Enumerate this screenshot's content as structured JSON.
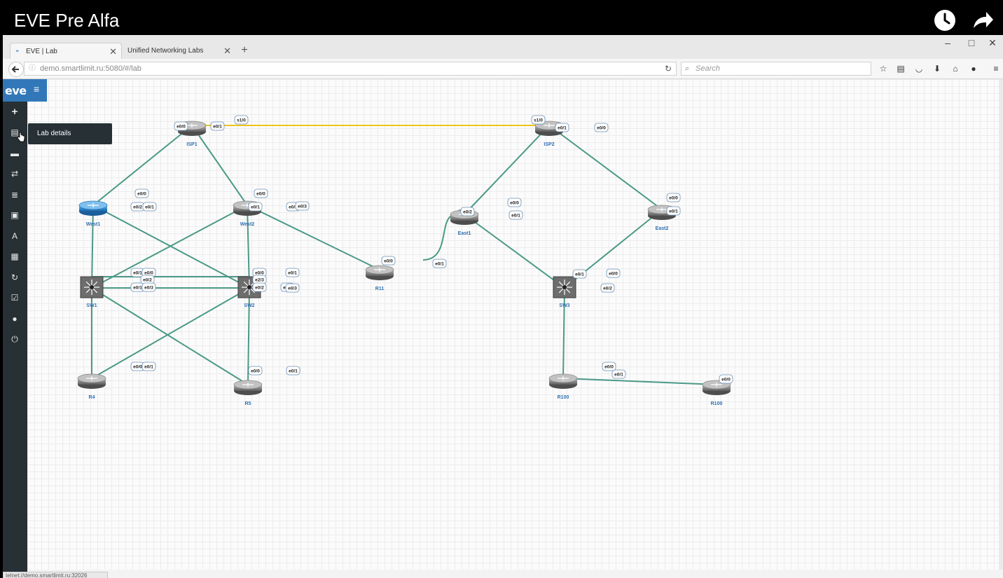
{
  "video": {
    "title": "EVE Pre Alfa",
    "icons": [
      "clock-icon",
      "share-icon"
    ]
  },
  "browser": {
    "tabs": [
      {
        "label": "EVE | Lab",
        "active": true
      },
      {
        "label": "Unified Networking Labs",
        "active": false
      }
    ],
    "new_tab": "+",
    "window_controls": [
      "–",
      "□",
      "✕"
    ],
    "url": "demo.smartlimit.ru:5080/#/lab",
    "search_placeholder": "Search",
    "status_url": "telnet://demo.smartlimit.ru:32026"
  },
  "app": {
    "logo": "eve",
    "tooltip": "Lab details",
    "sidebar_icons": [
      "plus-icon",
      "lab-details-icon",
      "node-icon",
      "network-icon",
      "list-icon",
      "picture-icon",
      "text-icon",
      "grid-icon",
      "refresh-icon",
      "check-icon",
      "info-icon",
      "power-icon"
    ]
  },
  "topology": {
    "nodes": [
      {
        "id": "ISP1",
        "label": "ISP1",
        "type": "router"
      },
      {
        "id": "ISP2",
        "label": "ISP2",
        "type": "router"
      },
      {
        "id": "West1",
        "label": "West1",
        "type": "router-active"
      },
      {
        "id": "West2",
        "label": "West2",
        "type": "router"
      },
      {
        "id": "R11",
        "label": "R11",
        "type": "router"
      },
      {
        "id": "East1",
        "label": "East1",
        "type": "router"
      },
      {
        "id": "East2",
        "label": "East2",
        "type": "router"
      },
      {
        "id": "SW1",
        "label": "SW1",
        "type": "switch"
      },
      {
        "id": "SW2",
        "label": "SW2",
        "type": "switch"
      },
      {
        "id": "SW3",
        "label": "SW3",
        "type": "switch"
      },
      {
        "id": "R4",
        "label": "R4",
        "type": "router"
      },
      {
        "id": "R5",
        "label": "R5",
        "type": "router"
      },
      {
        "id": "R100a",
        "label": "R100",
        "type": "router"
      },
      {
        "id": "R100b",
        "label": "R100",
        "type": "router"
      }
    ],
    "port_labels": [
      "e0/0",
      "e0/1",
      "s1/0",
      "s1/0",
      "e0/1",
      "e0/0",
      "e0/0",
      "e0/2",
      "e0/1",
      "e0/0",
      "e0/1",
      "e0/3",
      "e0/3",
      "e0/0",
      "e0/2",
      "e0/1",
      "e0/0",
      "e0/1",
      "e0/0",
      "e0/1",
      "e0/1",
      "e0/0",
      "e0/2",
      "e0/1",
      "e0/3",
      "e0/2",
      "e0/0",
      "e2/3",
      "e0/2",
      "e0/1",
      "e0/3",
      "e0/1",
      "e0/0",
      "e0/2",
      "e0/0",
      "e0/1",
      "e0/0",
      "e0/1",
      "e0/0",
      "e0/1",
      "e0/0"
    ]
  }
}
